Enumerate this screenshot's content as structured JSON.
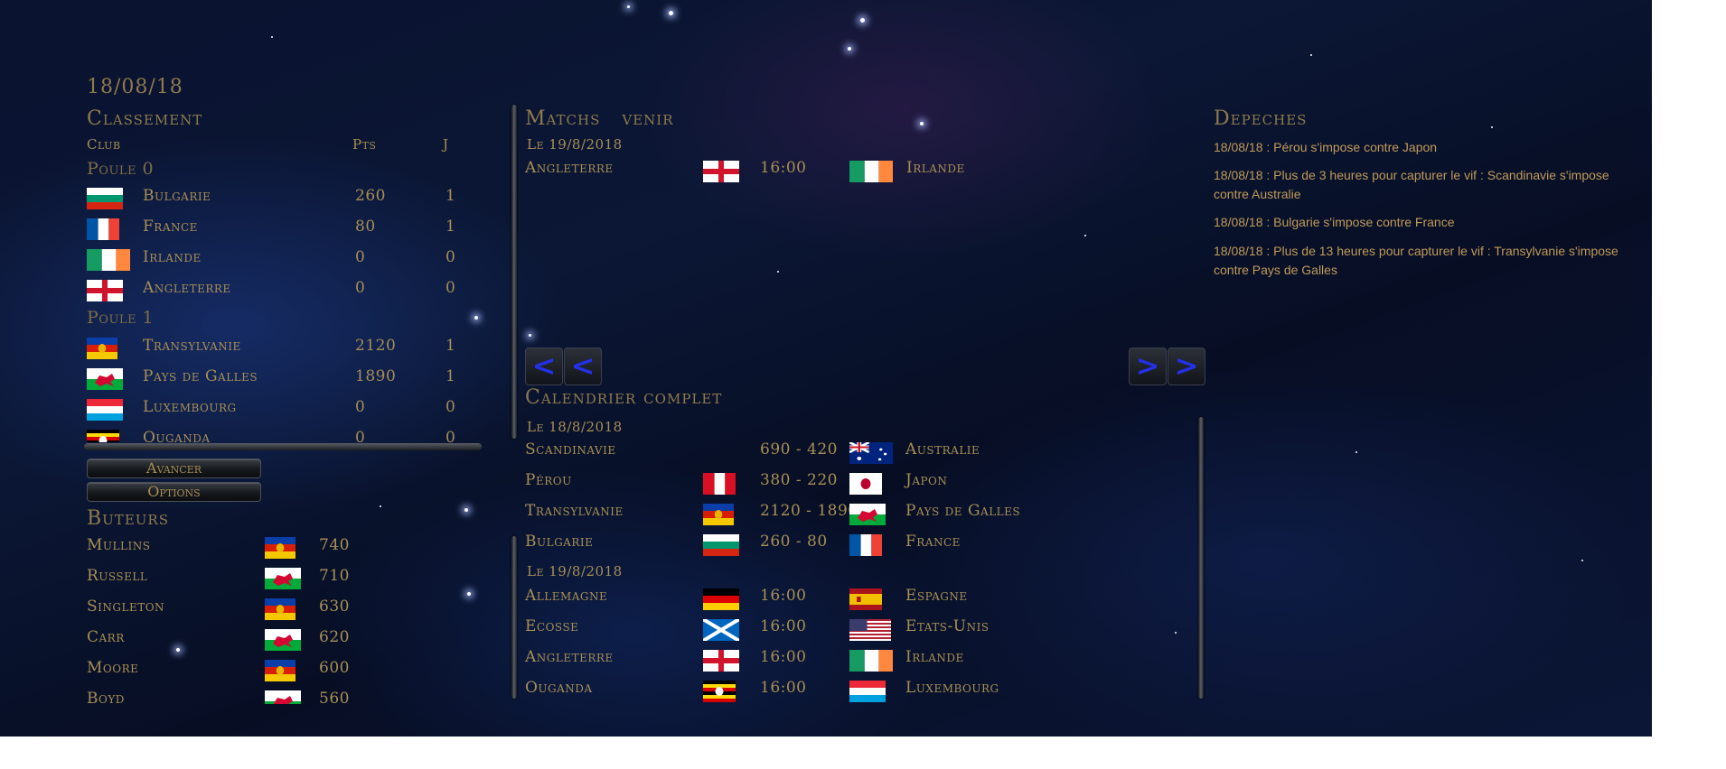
{
  "date": "18/08/18",
  "standings": {
    "title": "Classement",
    "col_club": "Club",
    "col_pts": "Pts",
    "col_j": "J",
    "groups": [
      {
        "name": "Poule 0",
        "rows": [
          {
            "club": "Bulgarie",
            "pts": "260",
            "j": "1",
            "flag": "bulgaria-flag-icon"
          },
          {
            "club": "France",
            "pts": "80",
            "j": "1",
            "flag": "france-flag-icon"
          },
          {
            "club": "Irlande",
            "pts": "0",
            "j": "0",
            "flag": "ireland-flag-icon"
          },
          {
            "club": "Angleterre",
            "pts": "0",
            "j": "0",
            "flag": "england-flag-icon"
          }
        ]
      },
      {
        "name": "Poule 1",
        "rows": [
          {
            "club": "Transylvanie",
            "pts": "2120",
            "j": "1",
            "flag": "transylvania-flag-icon"
          },
          {
            "club": "Pays de Galles",
            "pts": "1890",
            "j": "1",
            "flag": "wales-flag-icon"
          },
          {
            "club": "Luxembourg",
            "pts": "0",
            "j": "0",
            "flag": "luxembourg-flag-icon"
          },
          {
            "club": "Ouganda",
            "pts": "0",
            "j": "0",
            "flag": "uganda-flag-icon"
          }
        ]
      }
    ]
  },
  "buttons": {
    "advance": "Avancer",
    "options": "Options"
  },
  "scorers": {
    "title": "Buteurs",
    "rows": [
      {
        "name": "Mullins",
        "points": "740",
        "flag": "transylvania-flag-icon"
      },
      {
        "name": "Russell",
        "points": "710",
        "flag": "wales-flag-icon"
      },
      {
        "name": "Singleton",
        "points": "630",
        "flag": "transylvania-flag-icon"
      },
      {
        "name": "Carr",
        "points": "620",
        "flag": "wales-flag-icon"
      },
      {
        "name": "Moore",
        "points": "600",
        "flag": "transylvania-flag-icon"
      },
      {
        "name": "Boyd",
        "points": "560",
        "flag": "wales-flag-icon"
      }
    ]
  },
  "upcoming": {
    "title": "Matchs   venir",
    "date_label": "Le 19/8/2018",
    "match": {
      "home": "Angleterre",
      "home_flag": "england-flag-icon",
      "time": "16:00",
      "away": "Irlande",
      "away_flag": "ireland-flag-icon"
    }
  },
  "calendar": {
    "title": "Calendrier complet",
    "day1": "Le 18/8/2018",
    "day1_matches": [
      {
        "home": "Scandinavie",
        "home_flag": "",
        "result": "690 - 420",
        "away": "Australie",
        "away_flag": "australia-flag-icon"
      },
      {
        "home": "Pérou",
        "home_flag": "peru-flag-icon",
        "result": "380 - 220",
        "away": "Japon",
        "away_flag": "japan-flag-icon"
      },
      {
        "home": "Transylvanie",
        "home_flag": "transylvania-flag-icon",
        "result": "2120 - 1890",
        "away": "Pays de Galles",
        "away_flag": "wales-flag-icon"
      },
      {
        "home": "Bulgarie",
        "home_flag": "bulgaria-flag-icon",
        "result": "260 - 80",
        "away": "France",
        "away_flag": "france-flag-icon"
      }
    ],
    "day2": "Le 19/8/2018",
    "day2_matches": [
      {
        "home": "Allemagne",
        "home_flag": "germany-flag-icon",
        "result": "16:00",
        "away": "Espagne",
        "away_flag": "spain-flag-icon"
      },
      {
        "home": "Ecosse",
        "home_flag": "scotland-flag-icon",
        "result": "16:00",
        "away": "Etats-Unis",
        "away_flag": "usa-flag-icon"
      },
      {
        "home": "Angleterre",
        "home_flag": "england-flag-icon",
        "result": "16:00",
        "away": "Irlande",
        "away_flag": "ireland-flag-icon"
      },
      {
        "home": "Ouganda",
        "home_flag": "uganda-flag-icon",
        "result": "16:00",
        "away": "Luxembourg",
        "away_flag": "luxembourg-flag-icon"
      }
    ]
  },
  "news": {
    "title": "Depeches",
    "items": [
      "18/08/18 : Pérou s'impose contre Japon",
      "18/08/18 : Plus de 3 heures pour capturer le vif : Scandinavie s'impose contre Australie",
      "18/08/18 : Bulgarie s'impose contre France",
      "18/08/18 : Plus de 13 heures pour capturer le vif : Transylvanie s'impose contre Pays de Galles"
    ]
  },
  "nav": {
    "prev": "<",
    "next": ">"
  },
  "colors": {
    "text_gold": "#a88f55",
    "arrow_blue": "#2430e8",
    "background": "#0a1330"
  }
}
